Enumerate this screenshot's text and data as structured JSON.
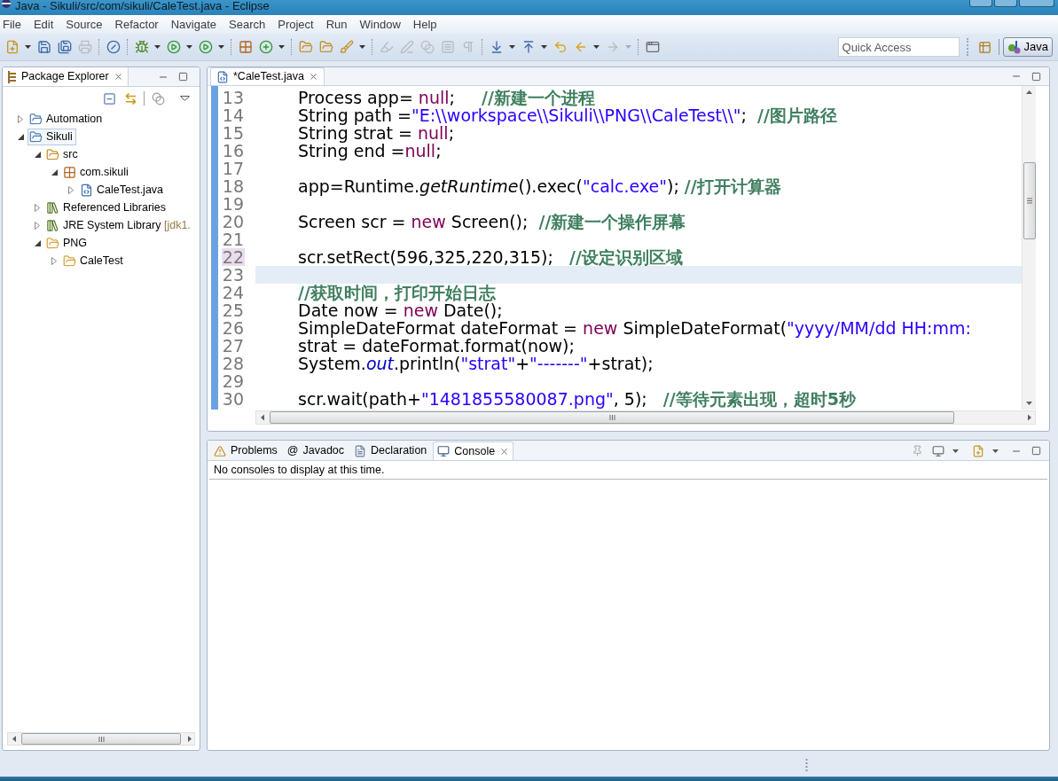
{
  "window": {
    "title": "Java - Sikuli/src/com/sikuli/CaleTest.java - Eclipse"
  },
  "menu": [
    "File",
    "Edit",
    "Source",
    "Refactor",
    "Navigate",
    "Search",
    "Project",
    "Run",
    "Window",
    "Help"
  ],
  "toolbar": [
    {
      "items": [
        {
          "kind": "new",
          "dropdown": true,
          "disabled": false
        },
        {
          "kind": "save",
          "dropdown": false,
          "disabled": false
        },
        {
          "kind": "save_all",
          "dropdown": false,
          "disabled": false
        },
        {
          "kind": "print",
          "dropdown": false,
          "disabled": true
        }
      ]
    },
    {
      "items": [
        {
          "kind": "skip_breakpoints",
          "dropdown": false,
          "disabled": false
        }
      ]
    },
    {
      "items": [
        {
          "kind": "debug",
          "dropdown": true,
          "disabled": false
        },
        {
          "kind": "run",
          "dropdown": true,
          "disabled": false
        },
        {
          "kind": "external_tools",
          "dropdown": true,
          "disabled": false
        }
      ]
    },
    {
      "items": [
        {
          "kind": "new_package",
          "dropdown": false,
          "disabled": false
        },
        {
          "kind": "new_class",
          "dropdown": true,
          "disabled": false
        }
      ]
    },
    {
      "items": [
        {
          "kind": "open_type",
          "dropdown": false,
          "disabled": false
        },
        {
          "kind": "open_task",
          "dropdown": false,
          "disabled": false
        },
        {
          "kind": "search",
          "dropdown": true,
          "disabled": false
        }
      ]
    },
    {
      "items": [
        {
          "kind": "highlight",
          "dropdown": false,
          "disabled": true
        },
        {
          "kind": "pen",
          "dropdown": false,
          "disabled": true
        },
        {
          "kind": "toggle",
          "dropdown": false,
          "disabled": true
        },
        {
          "kind": "block",
          "dropdown": false,
          "disabled": true
        },
        {
          "kind": "whitespace",
          "dropdown": false,
          "disabled": true
        }
      ]
    },
    {
      "items": [
        {
          "kind": "next_annotation",
          "dropdown": true,
          "disabled": false
        },
        {
          "kind": "prev_annotation",
          "dropdown": true,
          "disabled": false
        },
        {
          "kind": "last_edit",
          "dropdown": false,
          "disabled": false
        },
        {
          "kind": "back",
          "dropdown": true,
          "disabled": false
        },
        {
          "kind": "forward",
          "dropdown": true,
          "disabled": true
        }
      ]
    },
    {
      "items": [
        {
          "kind": "maximize",
          "dropdown": false,
          "disabled": false
        }
      ]
    }
  ],
  "quick_access": {
    "placeholder": "Quick Access"
  },
  "perspectives": [
    {
      "label": "Java",
      "selected": true
    }
  ],
  "package_explorer": {
    "title": "Package Explorer",
    "tree": [
      {
        "label": "Automation",
        "kind": "project",
        "expanded": false,
        "selected": false
      },
      {
        "label": "Sikuli",
        "kind": "project",
        "expanded": true,
        "selected": true,
        "children": [
          {
            "label": "src",
            "kind": "source_folder",
            "expanded": true,
            "selected": false,
            "children": [
              {
                "label": "com.sikuli",
                "kind": "package",
                "expanded": true,
                "selected": false,
                "children": [
                  {
                    "label": "CaleTest.java",
                    "kind": "java_file",
                    "expanded": false,
                    "selected": false
                  }
                ]
              }
            ]
          },
          {
            "label": "Referenced Libraries",
            "kind": "library",
            "expanded": false,
            "selected": false
          },
          {
            "label": "JRE System Library",
            "decoration": "[jdk1.",
            "kind": "library",
            "expanded": false,
            "selected": false
          },
          {
            "label": "PNG",
            "kind": "folder",
            "expanded": true,
            "selected": false,
            "children": [
              {
                "label": "CaleTest",
                "kind": "folder",
                "expanded": false,
                "selected": false
              }
            ]
          }
        ]
      }
    ]
  },
  "editor": {
    "tab": {
      "label": "*CaleTest.java"
    },
    "lines": [
      {
        "number": "13",
        "current": false,
        "marked": false,
        "tokens": [
          {
            "kind": "plain",
            "text": "Process app= "
          },
          {
            "kind": "keyword",
            "text": "null"
          },
          {
            "kind": "plain",
            "text": ";     "
          },
          {
            "kind": "comment",
            "text": "//新建一个进程"
          }
        ]
      },
      {
        "number": "14",
        "current": false,
        "marked": false,
        "tokens": [
          {
            "kind": "plain",
            "text": "String path ="
          },
          {
            "kind": "string",
            "text": "\"E:\\\\workspace\\\\Sikuli\\\\PNG\\\\CaleTest\\\\\""
          },
          {
            "kind": "plain",
            "text": ";  "
          },
          {
            "kind": "comment",
            "text": "//图片路径"
          }
        ]
      },
      {
        "number": "15",
        "current": false,
        "marked": false,
        "tokens": [
          {
            "kind": "plain",
            "text": "String strat = "
          },
          {
            "kind": "keyword",
            "text": "null"
          },
          {
            "kind": "plain",
            "text": ";"
          }
        ]
      },
      {
        "number": "16",
        "current": false,
        "marked": false,
        "tokens": [
          {
            "kind": "plain",
            "text": "String end ="
          },
          {
            "kind": "keyword",
            "text": "null"
          },
          {
            "kind": "plain",
            "text": ";"
          }
        ]
      },
      {
        "number": "17",
        "current": false,
        "marked": false
      },
      {
        "number": "18",
        "current": false,
        "marked": false,
        "tokens": [
          {
            "kind": "plain",
            "text": "app=Runtime."
          },
          {
            "kind": "static_method",
            "text": "getRuntime"
          },
          {
            "kind": "plain",
            "text": "().exec("
          },
          {
            "kind": "string",
            "text": "\"calc.exe\""
          },
          {
            "kind": "plain",
            "text": "); "
          },
          {
            "kind": "comment",
            "text": "//打开计算器"
          }
        ]
      },
      {
        "number": "19",
        "current": false,
        "marked": false
      },
      {
        "number": "20",
        "current": false,
        "marked": false,
        "tokens": [
          {
            "kind": "plain",
            "text": "Screen scr = "
          },
          {
            "kind": "keyword",
            "text": "new"
          },
          {
            "kind": "plain",
            "text": " Screen();  "
          },
          {
            "kind": "comment",
            "text": "//新建一个操作屏幕"
          }
        ]
      },
      {
        "number": "21",
        "current": false,
        "marked": false
      },
      {
        "number": "22",
        "current": false,
        "marked": true,
        "tokens": [
          {
            "kind": "plain",
            "text": "scr.setRect(596,325,220,315);   "
          },
          {
            "kind": "comment",
            "text": "//设定识别区域"
          }
        ]
      },
      {
        "number": "23",
        "current": true,
        "marked": false
      },
      {
        "number": "24",
        "current": false,
        "marked": false,
        "tokens": [
          {
            "kind": "comment",
            "text": "//获取时间，打印开始日志"
          }
        ]
      },
      {
        "number": "25",
        "current": false,
        "marked": false,
        "tokens": [
          {
            "kind": "plain",
            "text": "Date now = "
          },
          {
            "kind": "keyword",
            "text": "new"
          },
          {
            "kind": "plain",
            "text": " Date();"
          }
        ]
      },
      {
        "number": "26",
        "current": false,
        "marked": false,
        "tokens": [
          {
            "kind": "plain",
            "text": "SimpleDateFormat dateFormat = "
          },
          {
            "kind": "keyword",
            "text": "new"
          },
          {
            "kind": "plain",
            "text": " SimpleDateFormat("
          },
          {
            "kind": "string",
            "text": "\"yyyy/MM/dd HH:mm:"
          }
        ]
      },
      {
        "number": "27",
        "current": false,
        "marked": false,
        "tokens": [
          {
            "kind": "plain",
            "text": "strat = dateFormat.format(now);"
          }
        ]
      },
      {
        "number": "28",
        "current": false,
        "marked": false,
        "tokens": [
          {
            "kind": "plain",
            "text": "System."
          },
          {
            "kind": "static_field",
            "text": "out"
          },
          {
            "kind": "plain",
            "text": ".println("
          },
          {
            "kind": "string",
            "text": "\"strat\""
          },
          {
            "kind": "plain",
            "text": "+"
          },
          {
            "kind": "string",
            "text": "\"-------\""
          },
          {
            "kind": "plain",
            "text": "+strat);"
          }
        ]
      },
      {
        "number": "29",
        "current": false,
        "marked": false
      },
      {
        "number": "30",
        "current": false,
        "marked": false,
        "tokens": [
          {
            "kind": "plain",
            "text": "scr.wait(path+"
          },
          {
            "kind": "string",
            "text": "\"1481855580087.png\""
          },
          {
            "kind": "plain",
            "text": ", 5);   "
          },
          {
            "kind": "comment",
            "text": "//等待元素出现，超时5秒"
          }
        ]
      }
    ]
  },
  "bottom_panel": {
    "tabs": [
      {
        "label": "Problems",
        "kind": "problems",
        "selected": false
      },
      {
        "label": "Javadoc",
        "glyph": "@",
        "kind": "javadoc",
        "selected": false
      },
      {
        "label": "Declaration",
        "kind": "declaration",
        "selected": false
      },
      {
        "label": "Console",
        "kind": "console",
        "selected": true
      }
    ],
    "message": "No consoles to display at this time."
  }
}
